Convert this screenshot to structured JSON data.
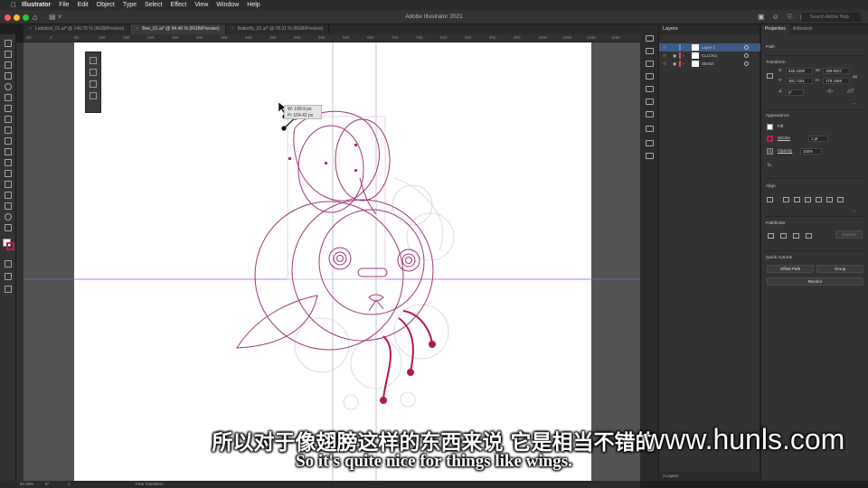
{
  "menubar": {
    "app": "Illustrator",
    "items": [
      "File",
      "Edit",
      "Object",
      "Type",
      "Select",
      "Effect",
      "View",
      "Window",
      "Help"
    ]
  },
  "appbar": {
    "title": "Adobe Illustrator 2021",
    "search_placeholder": "Search Adobe Help"
  },
  "tabs": [
    {
      "label": "Ladybird_01.ai* @ 146.79 % (RGB/Preview)",
      "active": false
    },
    {
      "label": "Bee_01.ai* @ 94.46 % (RGB/Preview)",
      "active": true
    },
    {
      "label": "Butterfly_01.ai* @ 78.31 % (RGB/Preview)",
      "active": false
    }
  ],
  "ruler": {
    "ticks": [
      "-50",
      "0",
      "50",
      "100",
      "150",
      "200",
      "250",
      "300",
      "350",
      "400",
      "450",
      "500",
      "550",
      "600",
      "650",
      "700",
      "750",
      "800",
      "850",
      "900",
      "950",
      "1000",
      "1050",
      "1100",
      "1150"
    ]
  },
  "tooltip": {
    "width": "W: 199.9 px",
    "height": "H: 104.42 px"
  },
  "layers": {
    "header": "Layers",
    "rows": [
      {
        "name": "Layer 1",
        "color": "#4a90e2",
        "selected": true
      },
      {
        "name": "CLLOS1",
        "color": "#e24a4a",
        "selected": false
      },
      {
        "name": "Sketch",
        "color": "#e24a4a",
        "selected": false
      }
    ],
    "footer": "3 Layers"
  },
  "properties": {
    "tabs": [
      "Properties",
      "Artboards"
    ],
    "selection_type": "Path",
    "transform": {
      "title": "Transform",
      "x_label": "X:",
      "x": "548.1008",
      "y_label": "Y:",
      "y": "291.7151",
      "w_label": "W:",
      "w": "199.9027",
      "h_label": "H:",
      "h": "178.1669",
      "angle": "0°"
    },
    "appearance": {
      "title": "Appearance",
      "fill_label": "Fill",
      "stroke_label": "Stroke",
      "stroke_value": "1 pt",
      "opacity_label": "Opacity",
      "opacity_value": "100%",
      "fx_label": "fx."
    },
    "align_title": "Align",
    "pathfinder_title": "Pathfinder",
    "pathfinder_expand": "Expand",
    "quick_actions": {
      "title": "Quick Actions",
      "offset_path": "Offset Path",
      "group": "Group",
      "recolor": "Recolor"
    }
  },
  "status": {
    "zoom": "94.46%",
    "angle": "0°",
    "artboard": "1",
    "tool": "Free Transform"
  },
  "subtitles": {
    "chinese": "所以对于像翅膀这样的东西来说 它是相当不错的",
    "english": "So it's quite nice for things like wings."
  },
  "watermark": "www.hunls.com",
  "colors": {
    "accent": "#4a90e2",
    "artwork_stroke": "#a0367a",
    "artwork_fill": "#b5174f",
    "guide": "#9b4fd6"
  }
}
